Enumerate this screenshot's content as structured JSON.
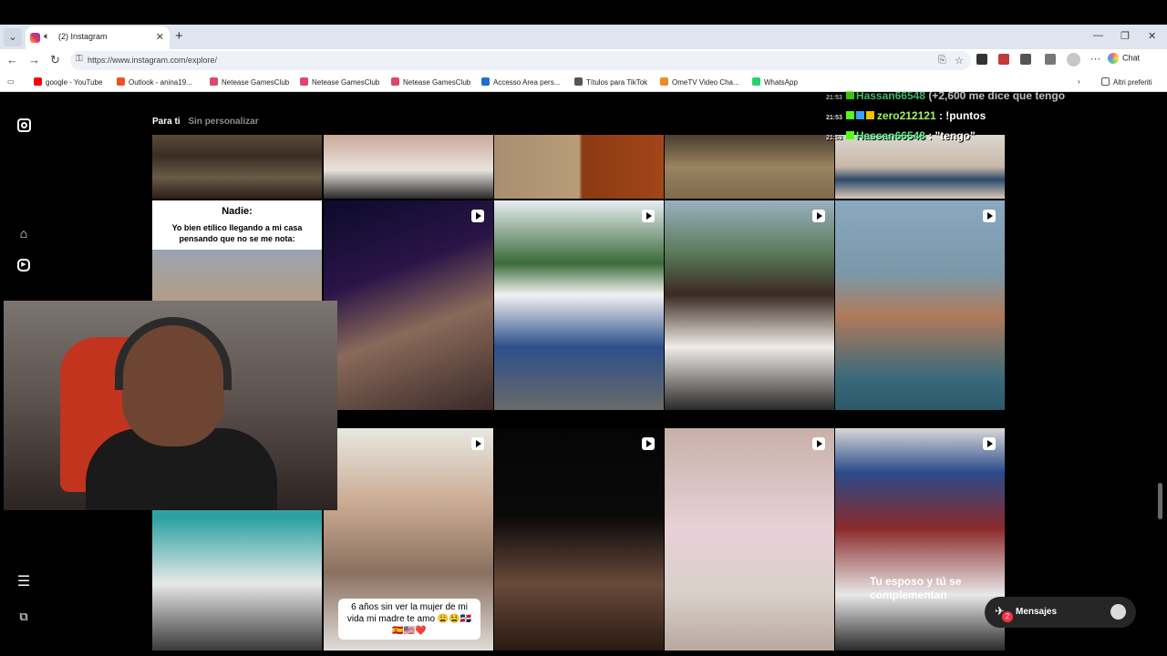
{
  "browser": {
    "tab_title": "(2) Instagram",
    "url": "https://www.instagram.com/explore/",
    "chat_label": "Chat",
    "other_favorites": "Altri preferiti",
    "bookmarks": [
      {
        "label": "google - YouTube",
        "color": "#ff0000"
      },
      {
        "label": "Outlook - anina19...",
        "color": "#0f6cbd"
      },
      {
        "label": "Netease GamesClub",
        "color": "#e0456b"
      },
      {
        "label": "Netease GamesClub",
        "color": "#e0456b"
      },
      {
        "label": "Netease GamesClub",
        "color": "#e0456b"
      },
      {
        "label": "Accesso Area pers...",
        "color": "#1f6fd1"
      },
      {
        "label": "Títulos para TikTok",
        "color": "#555555"
      },
      {
        "label": "OmeTV Video Cha...",
        "color": "#f08a24"
      },
      {
        "label": "WhatsApp",
        "color": "#25d366"
      }
    ]
  },
  "instagram": {
    "feed_tabs": {
      "active": "Para ti",
      "inactive": "Sin personalizar"
    },
    "meme": {
      "line1": "Nadie:",
      "line2": "Yo bien etílico llegando a mi casa pensando que no se me nota:"
    },
    "caption_mother": "6 años sin ver la mujer de mi vida mi madre te amo 😩😫🇩🇴🇪🇸🇺🇸❤️",
    "caption_esposo": "Tu esposo y tú se complementan",
    "messages": {
      "label": "Mensajes",
      "count": "2"
    }
  },
  "stream_chat": [
    {
      "time": "21:53",
      "user": "Hassan66548",
      "text": "(+2,600 me dice que tengo",
      "style": "faded"
    },
    {
      "time": "21:53",
      "user": "zero212121",
      "text": ": !puntos",
      "style": "a"
    },
    {
      "time": "21:53",
      "user": "Hassan66548",
      "text": ": \"tengo\"",
      "style": "b"
    }
  ],
  "colors": {
    "instagram_bg": "#000000",
    "browser_chrome": "#dfe4ee",
    "accent_badge": "#ff3040"
  }
}
